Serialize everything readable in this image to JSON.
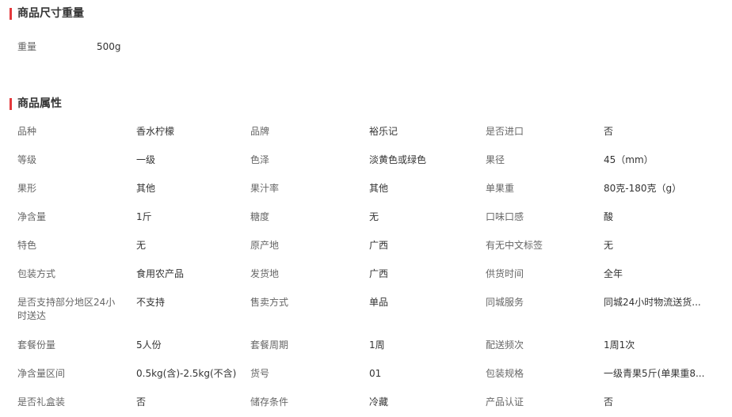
{
  "sections": {
    "size_weight": {
      "title": "商品尺寸重量",
      "weight_label": "重量",
      "weight_value": "500g"
    },
    "attributes": {
      "title": "商品属性",
      "rows": [
        [
          [
            "品种",
            "香水柠檬"
          ],
          [
            "品牌",
            "裕乐记"
          ],
          [
            "是否进口",
            "否"
          ]
        ],
        [
          [
            "等级",
            "一级"
          ],
          [
            "色泽",
            "淡黄色或绿色"
          ],
          [
            "果径",
            "45（mm）"
          ]
        ],
        [
          [
            "果形",
            "其他"
          ],
          [
            "果汁率",
            "其他"
          ],
          [
            "单果重",
            "80克-180克（g）"
          ]
        ],
        [
          [
            "净含量",
            "1斤"
          ],
          [
            "糖度",
            "无"
          ],
          [
            "口味口感",
            "酸"
          ]
        ],
        [
          [
            "特色",
            "无"
          ],
          [
            "原产地",
            "广西"
          ],
          [
            "有无中文标签",
            "无"
          ]
        ],
        [
          [
            "包装方式",
            "食用农产品"
          ],
          [
            "发货地",
            "广西"
          ],
          [
            "供货时间",
            "全年"
          ]
        ],
        [
          [
            "是否支持部分地区24小时送达",
            "不支持"
          ],
          [
            "售卖方式",
            "单品"
          ],
          [
            "同城服务",
            "同城24小时物流送货..."
          ]
        ],
        [
          [
            "套餐份量",
            "5人份"
          ],
          [
            "套餐周期",
            "1周"
          ],
          [
            "配送频次",
            "1周1次"
          ]
        ],
        [
          [
            "净含量区间",
            "0.5kg(含)-2.5kg(不含)"
          ],
          [
            "货号",
            "01"
          ],
          [
            "包装规格",
            "一级青果5斤(单果重8..."
          ]
        ],
        [
          [
            "是否礼盒装",
            "否"
          ],
          [
            "储存条件",
            "冷藏"
          ],
          [
            "产品认证",
            "否"
          ]
        ]
      ]
    }
  },
  "colors": {
    "accent_bar": "#e4393c",
    "label_text": "#666666",
    "value_text": "#333333"
  }
}
